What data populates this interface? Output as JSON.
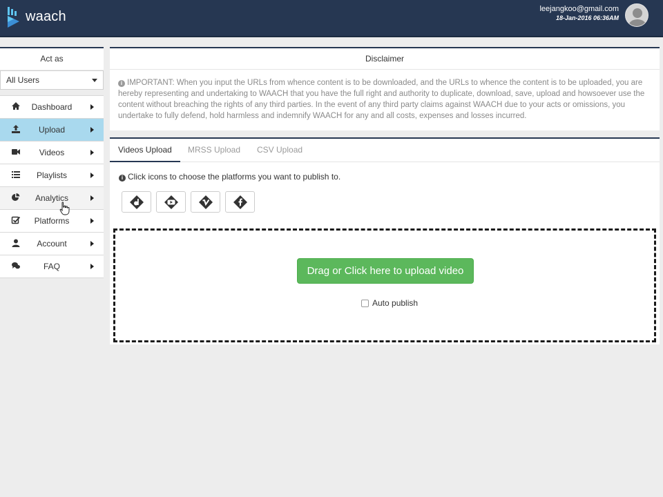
{
  "header": {
    "logo_text": "waach",
    "user_email": "leejangkoo@gmail.com",
    "user_date": "18-Jan-2016 06:36AM"
  },
  "sidebar": {
    "act_as_label": "Act as",
    "act_as_value": "All Users",
    "items": [
      {
        "label": "Dashboard",
        "icon": "home-icon"
      },
      {
        "label": "Upload",
        "icon": "upload-icon"
      },
      {
        "label": "Videos",
        "icon": "video-camera-icon"
      },
      {
        "label": "Playlists",
        "icon": "list-icon"
      },
      {
        "label": "Analytics",
        "icon": "pie-chart-icon"
      },
      {
        "label": "Platforms",
        "icon": "checkbox-icon"
      },
      {
        "label": "Account",
        "icon": "user-icon"
      },
      {
        "label": "FAQ",
        "icon": "comments-icon"
      }
    ],
    "active_item": "Upload"
  },
  "disclaimer": {
    "title": "Disclaimer",
    "text": "IMPORTANT: When you input the URLs from whence content is to be downloaded, and the URLs to whence the content is to be uploaded, you are hereby representing and undertaking to WAACH that you have the full right and authority to duplicate, download, save, upload and howsoever use the content without breaching the rights of any third parties. In the event of any third party claims against WAACH due to your acts or omissions, you undertake to fully defend, hold harmless and indemnify WAACH for any and all costs, expenses and losses incurred."
  },
  "upload": {
    "tabs": [
      "Videos Upload",
      "MRSS Upload",
      "CSV Upload"
    ],
    "active_tab": "Videos Upload",
    "instructions": "Click icons to choose the platforms you want to publish to.",
    "platforms": [
      "dailymotion-icon",
      "youtube-icon",
      "vimeo-icon",
      "facebook-icon"
    ],
    "upload_button": "Drag or Click here to upload video",
    "auto_publish_label": "Auto publish"
  },
  "colors": {
    "header_bg": "#263752",
    "active_nav": "#a9d9ee",
    "upload_button": "#5cb85c"
  }
}
